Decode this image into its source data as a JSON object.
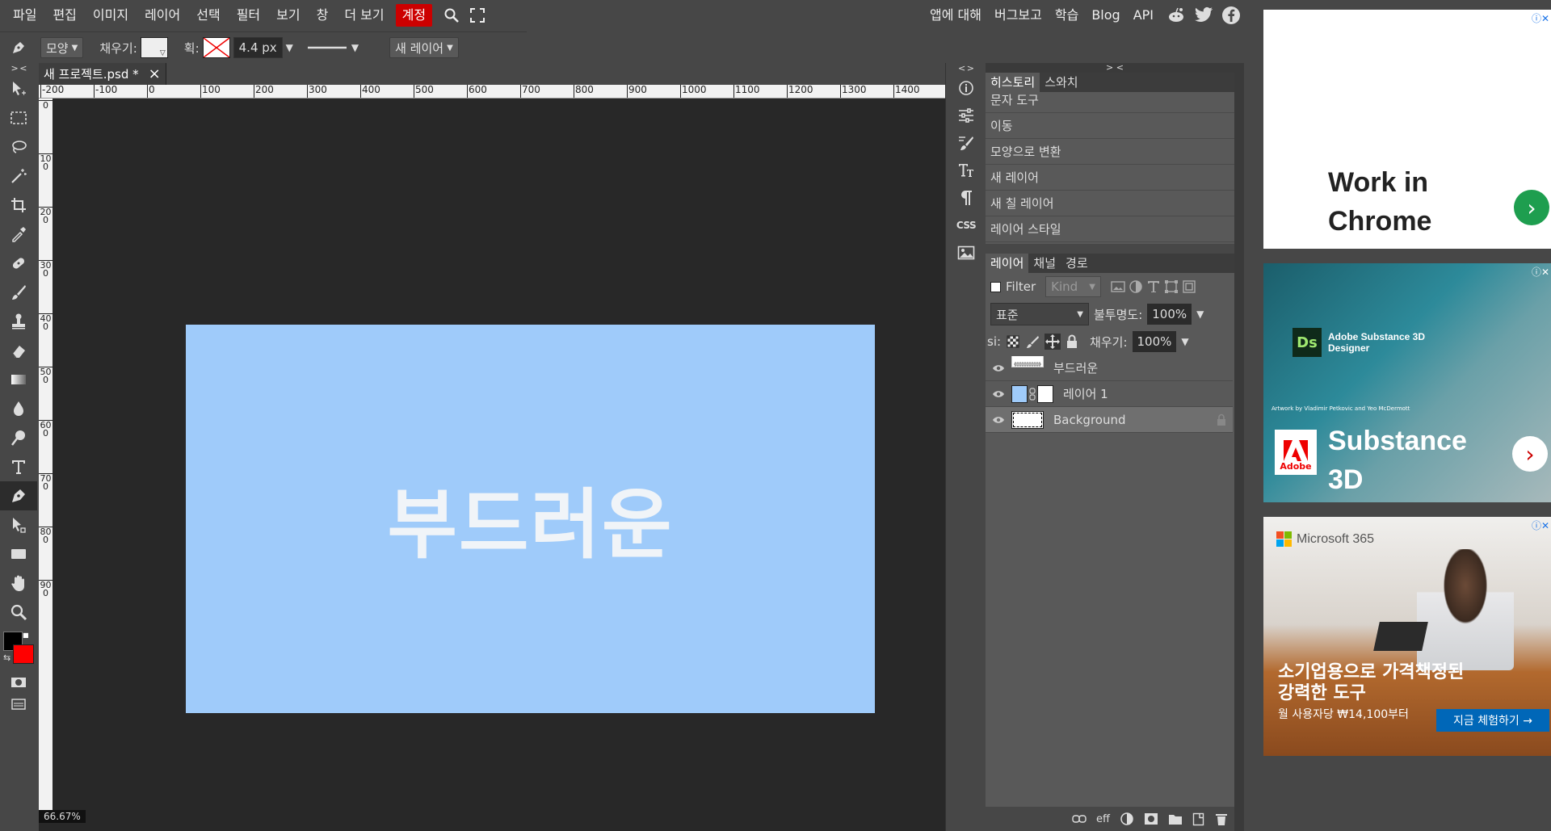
{
  "menu": {
    "items": [
      "파일",
      "편집",
      "이미지",
      "레이어",
      "선택",
      "필터",
      "보기",
      "창",
      "더 보기"
    ],
    "account": "계정",
    "right": [
      "앱에 대해",
      "버그보고",
      "학습",
      "Blog",
      "API"
    ]
  },
  "options": {
    "shape_mode": "모양",
    "fill_label": "채우기:",
    "stroke_label": "획:",
    "stroke_width": "4.4 px",
    "new_layer": "새 레이어"
  },
  "toolbar": {
    "header": "> <"
  },
  "document": {
    "tab_title": "새 프로젝트.psd *",
    "close_icon": "×",
    "canvas_text": "부드러운",
    "canvas_color": "#9fcbfa",
    "zoom": "66.67%",
    "ruler_h": [
      "-200",
      "-100",
      "0",
      "100",
      "200",
      "300",
      "400",
      "500",
      "600",
      "700",
      "800",
      "900",
      "1000",
      "1100",
      "1200",
      "1300",
      "1400"
    ],
    "ruler_v": [
      "0",
      "100",
      "200",
      "300",
      "400",
      "500",
      "600",
      "700",
      "800",
      "900"
    ]
  },
  "mid_panel": {
    "header": "< >",
    "css_label": "CSS"
  },
  "history": {
    "header": "> <",
    "tabs": [
      "히스토리",
      "스와치"
    ],
    "items": [
      "문자 도구",
      "이동",
      "모양으로 변환",
      "새 레이어",
      "새 칠 레이어",
      "레이어 스타일"
    ]
  },
  "layers": {
    "tabs": [
      "레이어",
      "채널",
      "경로"
    ],
    "filter_label": "Filter",
    "kind_placeholder": "Kind",
    "blend_mode": "표준",
    "opacity_label": "불투명도:",
    "opacity": "100%",
    "lock_label": "si:",
    "fill_label": "채우기:",
    "fill": "100%",
    "items": [
      {
        "name": "부드러운"
      },
      {
        "name": "레이어 1"
      },
      {
        "name": "Background"
      }
    ],
    "footer_eff": "eff"
  },
  "ads": {
    "ad1": {
      "title_line1": "Work in",
      "title_line2": "Chrome"
    },
    "ad2": {
      "brand": "Adobe Substance 3D Designer",
      "ds": "Ds",
      "credit": "Artwork by Vladimir Petkovic and Yeo McDermott",
      "title_line1": "Substance",
      "title_line2": "3D",
      "logo_text": "Adobe"
    },
    "ad3": {
      "brand": "Microsoft 365",
      "title_line1": "소기업용으로 가격책정된",
      "title_line2": "강력한 도구",
      "price": "월 사용자당 ₩14,100부터",
      "cta": "지금 체험하기 →"
    }
  }
}
